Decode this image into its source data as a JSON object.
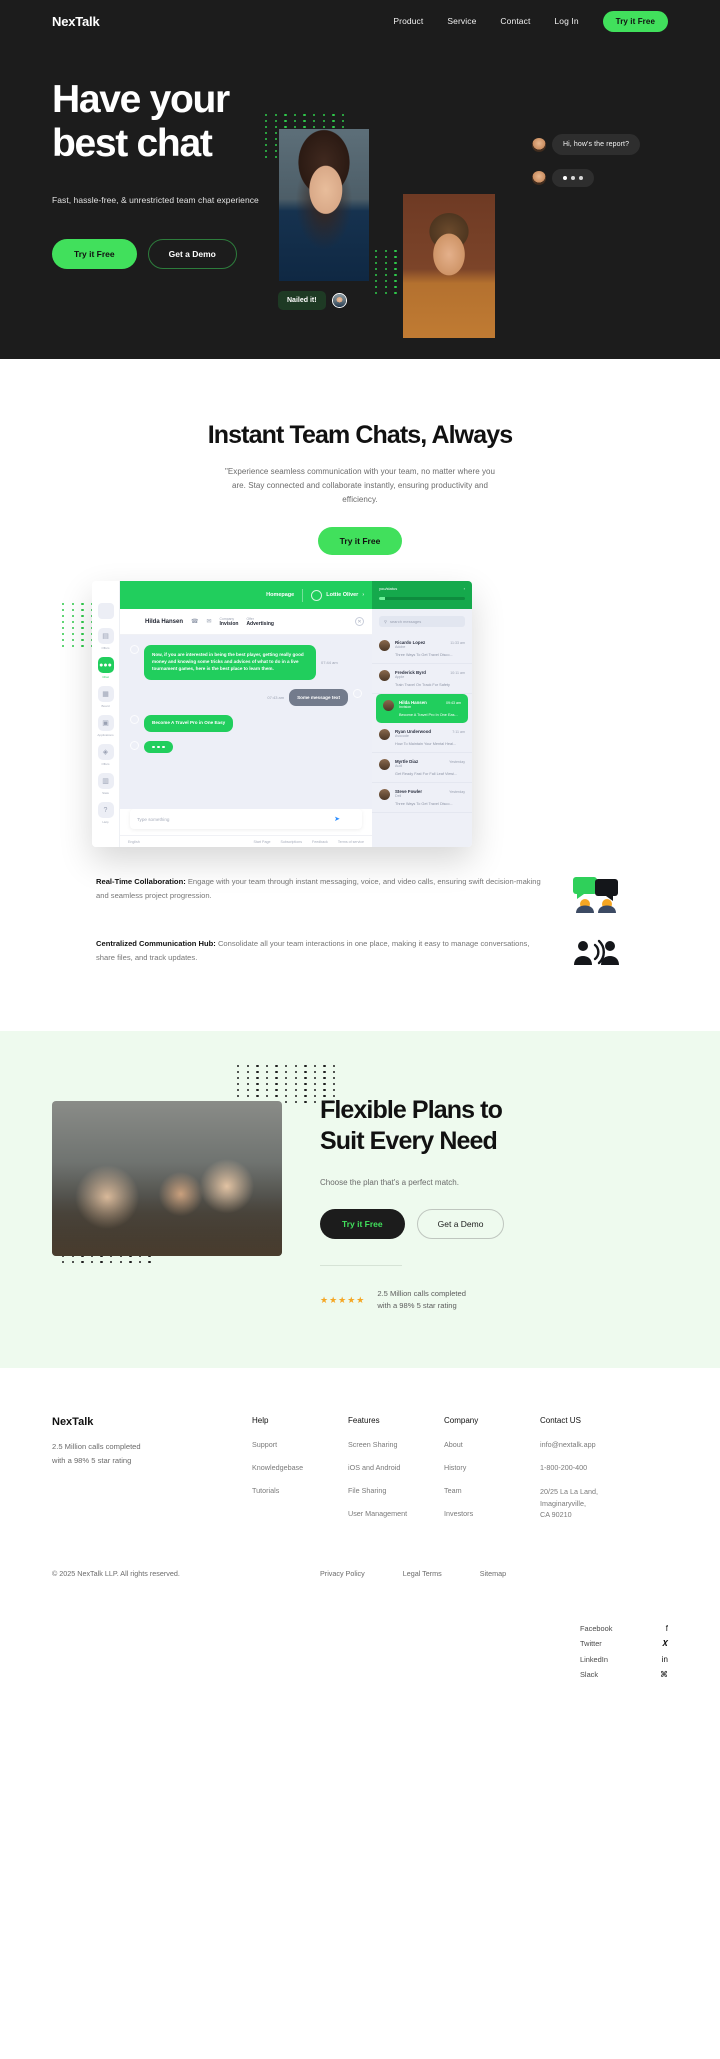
{
  "nav": {
    "brand": "NexTalk",
    "links": [
      "Product",
      "Service",
      "Contact",
      "Log In"
    ],
    "cta": "Try it Free"
  },
  "hero": {
    "title_line1": "Have your",
    "title_line2": "best chat",
    "subtitle": "Fast, hassle-free, & unrestricted team chat experience",
    "primary_cta": "Try it Free",
    "secondary_cta": "Get a Demo",
    "bubble_message": "Hi, how's the report?",
    "bubble_typing": "typing-indicator",
    "tag_message": "Nailed it!"
  },
  "instant": {
    "title": "Instant Team Chats, Always",
    "subtitle": "\"Experience seamless communication with your team, no matter where you are. Stay connected and collaborate instantly, ensuring productivity and efficiency.",
    "cta": "Try it Free"
  },
  "mockup": {
    "rail": [
      {
        "label": "Offers",
        "icon": "briefcase-icon",
        "active": false
      },
      {
        "label": "Chat",
        "icon": "chat-icon",
        "active": true
      },
      {
        "label": "Board",
        "icon": "board-icon",
        "active": false
      },
      {
        "label": "Applications",
        "icon": "applications-icon",
        "active": false
      },
      {
        "label": "Offers",
        "icon": "tag-icon",
        "active": false
      },
      {
        "label": "Stats",
        "icon": "stats-icon",
        "active": false
      },
      {
        "label": "Help",
        "icon": "help-icon",
        "active": false
      }
    ],
    "topbar": {
      "link": "Homepage",
      "user": "Lottie Oliver",
      "chevron": "›"
    },
    "contact": {
      "name": "Hilda Hansen",
      "company_label": "Company",
      "company_value": "Invision",
      "offer_label": "Offer",
      "offer_value": "Advertising"
    },
    "messages": [
      {
        "side": "left",
        "text": "Now, if you are interested in being the best player, getting really good money and knowing some tricks and advices of what to do in a live tournament games, here is the best place to learn them.",
        "time": "07:44 am",
        "style": "green"
      },
      {
        "side": "right",
        "text": "Some message text",
        "time": "07:43 am",
        "style": "gray"
      },
      {
        "side": "left",
        "text": "Become A Travel Pro in One Easy",
        "time": "",
        "style": "green-sm"
      },
      {
        "side": "left",
        "text": "typing",
        "time": "",
        "style": "dots"
      }
    ],
    "composer": {
      "placeholder": "Type something",
      "send_icon": "send-icon"
    },
    "footer": {
      "lang": "English",
      "links": [
        "Start Page",
        "Subscriptions",
        "Feedback",
        "Terms of service"
      ]
    },
    "right_panel": {
      "header_label": "you/status",
      "progress_percent": 7,
      "search_placeholder": "search messages",
      "items": [
        {
          "name": "Ricardo Lopez",
          "company": "Adobe",
          "time": "11:33 am",
          "preview": "Three Ways To Get Travel Disco...",
          "active": false
        },
        {
          "name": "Frederick Byrd",
          "company": "Apple",
          "time": "10:11 am",
          "preview": "Train Travel On Track For Safety",
          "active": false
        },
        {
          "name": "Hilda Hansen",
          "company": "Invision",
          "time": "09:43 am",
          "preview": "Become A Travel Pro In One Eas...",
          "active": true
        },
        {
          "name": "Ryan Underwood",
          "company": "Avocode",
          "time": "7:11 am",
          "preview": "How To Maintain Your Mental Heal...",
          "active": false
        },
        {
          "name": "Myrtle Diaz",
          "company": "Audi",
          "time": "Yesterday",
          "preview": "Get Ready Fast For Fall Leaf Viewi...",
          "active": false
        },
        {
          "name": "Steve Fowler",
          "company": "Dell",
          "time": "Yesterday",
          "preview": "Three Ways To Get Travel Disco...",
          "active": false
        }
      ]
    }
  },
  "features": [
    {
      "title": "Real-Time Collaboration:",
      "body": " Engage with your team through instant messaging, voice, and video calls, ensuring swift decision-making and seamless project progression.",
      "icon": "chat-bubbles-people-icon"
    },
    {
      "title": "Centralized Communication Hub:",
      "body": " Consolidate all your team interactions in one place, making it easy to manage conversations, share files, and track updates.",
      "icon": "speaking-people-icon"
    }
  ],
  "plans": {
    "title_line1": "Flexible Plans to",
    "title_line2": "Suit Every Need",
    "subtitle": "Choose the plan that's a perfect match.",
    "primary_cta": "Try it Free",
    "secondary_cta": "Get a Demo",
    "stars": "★★★★★",
    "rating_line1": "2.5 Million calls completed",
    "rating_line2": "with a 98% 5 star rating"
  },
  "footer": {
    "brand": "NexTalk",
    "brand_sub_line1": "2.5 Million calls completed",
    "brand_sub_line2": "with a 98% 5 star rating",
    "columns": [
      {
        "heading": "Help",
        "items": [
          "Support",
          "Knowledgebase",
          "Tutorials"
        ]
      },
      {
        "heading": "Features",
        "items": [
          "Screen Sharing",
          "iOS and Android",
          "File Sharing",
          "User Management"
        ]
      },
      {
        "heading": "Company",
        "items": [
          "About",
          "History",
          "Team",
          "Investors"
        ]
      }
    ],
    "contact": {
      "heading": "Contact US",
      "email": "info@nextalk.app",
      "phone": "1-800-200-400",
      "address_line1": "20/25 La La Land,",
      "address_line2": "Imaginaryville,",
      "address_line3": "CA 90210"
    },
    "copyright": "© 2025 NexTalk LLP. All rights reserved.",
    "legal": [
      "Privacy Policy",
      "Legal Terms",
      "Sitemap"
    ],
    "socials": [
      {
        "label": "Facebook",
        "glyph": "f",
        "icon": "facebook-icon"
      },
      {
        "label": "Twitter",
        "glyph": "𝑿",
        "icon": "twitter-x-icon"
      },
      {
        "label": "LinkedIn",
        "glyph": "in",
        "icon": "linkedin-icon"
      },
      {
        "label": "Slack",
        "glyph": "⌘",
        "icon": "slack-icon"
      }
    ]
  },
  "colors": {
    "accent_green": "#41e05c",
    "app_green": "#21ce5d",
    "dark": "#1c1c1c",
    "mint_bg": "#eefaee",
    "star": "#f5a623"
  }
}
